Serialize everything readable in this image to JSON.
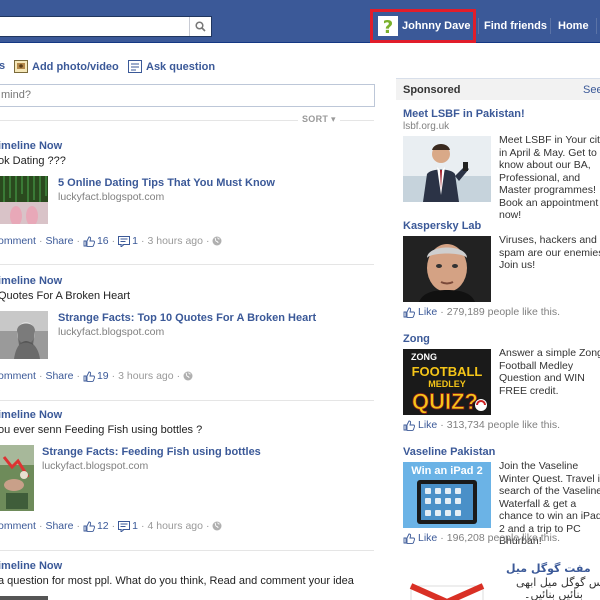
{
  "topbar": {
    "search_placeholder": "",
    "profile_name": "Johnny Dave",
    "nav": [
      "Find friends",
      "Home"
    ]
  },
  "composer": {
    "items": [
      {
        "label": "s",
        "icon": "status-icon"
      },
      {
        "label": "Add photo/video",
        "icon": "photo-icon"
      },
      {
        "label": "Ask question",
        "icon": "question-icon"
      }
    ],
    "placeholder": "mind?",
    "sort_label": "SORT"
  },
  "stories": [
    {
      "title": "imeline Now",
      "text": "ok Dating ???",
      "link_title": "5 Online Dating Tips That You Must Know",
      "domain": "luckyfact.blogspot.com",
      "comment": "omment",
      "share": "Share",
      "likes": "16",
      "comments": "1",
      "time": "3 hours ago"
    },
    {
      "title": "imeline Now",
      "text": "Quotes For A Broken Heart",
      "link_title": "Strange Facts: Top 10 Quotes For A Broken Heart",
      "domain": "luckyfact.blogspot.com",
      "comment": "omment",
      "share": "Share",
      "likes": "19",
      "comments": "",
      "time": "3 hours ago"
    },
    {
      "title": "imeline Now",
      "text": "ou ever senn Feeding Fish using bottles ?",
      "link_title": "Strange Facts: Feeding Fish using bottles",
      "domain": "luckyfact.blogspot.com",
      "comment": "omment",
      "share": "Share",
      "likes": "12",
      "comments": "1",
      "time": "4 hours ago"
    },
    {
      "title": "imeline Now",
      "text": "a question for most ppl. What do you think, Read and comment your idea"
    }
  ],
  "sidebar": {
    "title": "Sponsored",
    "see_all": "See",
    "ads": [
      {
        "title": "Meet LSBF in Pakistan!",
        "domain": "lsbf.org.uk",
        "text": "Meet LSBF in Your city in April & May. Get to know about our BA, Professional, and Master programmes! Book an appointment now!"
      },
      {
        "title": "Kaspersky Lab",
        "text": "Viruses, hackers and spam are our enemies. Join us!",
        "like_label": "Like",
        "like_count": "279,189 people like this."
      },
      {
        "title": "Zong",
        "text": "Answer a simple Zong Football Medley Question and WIN FREE credit.",
        "img_text": [
          "ZONG",
          "FOOTBALL",
          "MEDLEY",
          "QUIZ?"
        ],
        "like_label": "Like",
        "like_count": "313,734 people like this."
      },
      {
        "title": "Vaseline Pakistan",
        "text": "Join the Vaseline Winter Quest. Travel in search of the Vaseline Waterfall & get a chance to win an iPad 2 and a trip to PC Bhurban!",
        "img_text": "Win an iPad 2",
        "like_label": "Like",
        "like_count": "196,208 people like this."
      }
    ],
    "urdu_lines": [
      "مفت گوگل میل",
      "بس گوگل میل ابھی",
      "بنائیں بنائیں۔"
    ]
  },
  "colors": {
    "brand": "#3b5998",
    "highlight": "#e11d2a"
  }
}
